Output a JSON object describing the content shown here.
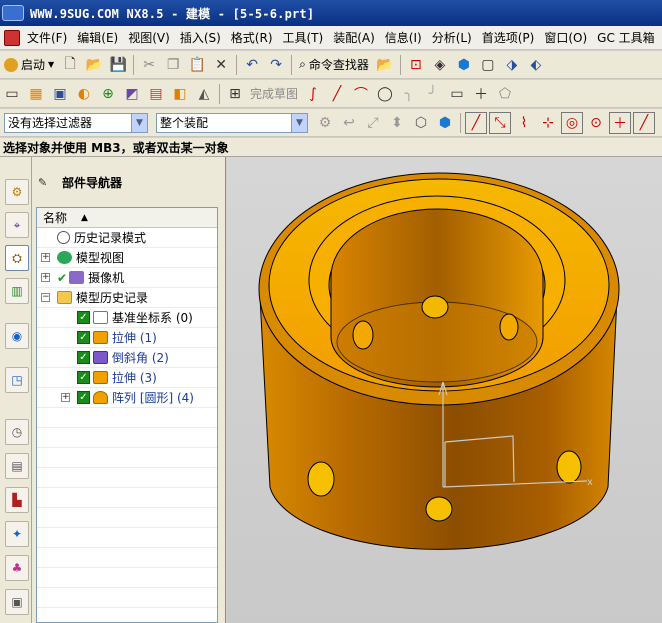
{
  "window": {
    "title": "WWW.9SUG.COM NX8.5 - 建模 - [5-5-6.prt]"
  },
  "menu": [
    "文件(F)",
    "编辑(E)",
    "视图(V)",
    "插入(S)",
    "格式(R)",
    "工具(T)",
    "装配(A)",
    "信息(I)",
    "分析(L)",
    "首选项(P)",
    "窗口(O)",
    "GC 工具箱"
  ],
  "toolbar": {
    "start_label": "启动",
    "command_finder_label": "命令查找器",
    "finish_sketch_label": "完成草图"
  },
  "filters": {
    "type_filter": "没有选择过滤器",
    "scope_filter": "整个装配"
  },
  "status": {
    "prompt": "选择对象并使用 MB3，或者双击某一对象"
  },
  "navigator": {
    "title": "部件导航器",
    "column_name": "名称",
    "nodes": [
      {
        "label": "历史记录模式"
      },
      {
        "label": "模型视图"
      },
      {
        "label": "摄像机"
      },
      {
        "label": "模型历史记录"
      },
      {
        "label": "基准坐标系 (0)"
      },
      {
        "label": "拉伸 (1)"
      },
      {
        "label": "倒斜角 (2)"
      },
      {
        "label": "拉伸 (3)"
      },
      {
        "label": "阵列 [圆形] (4)"
      }
    ]
  },
  "colors": {
    "part": "#f0a000",
    "part_dark": "#c07000",
    "background": "#cfcfcf",
    "title_bar": "#0a2f82"
  }
}
